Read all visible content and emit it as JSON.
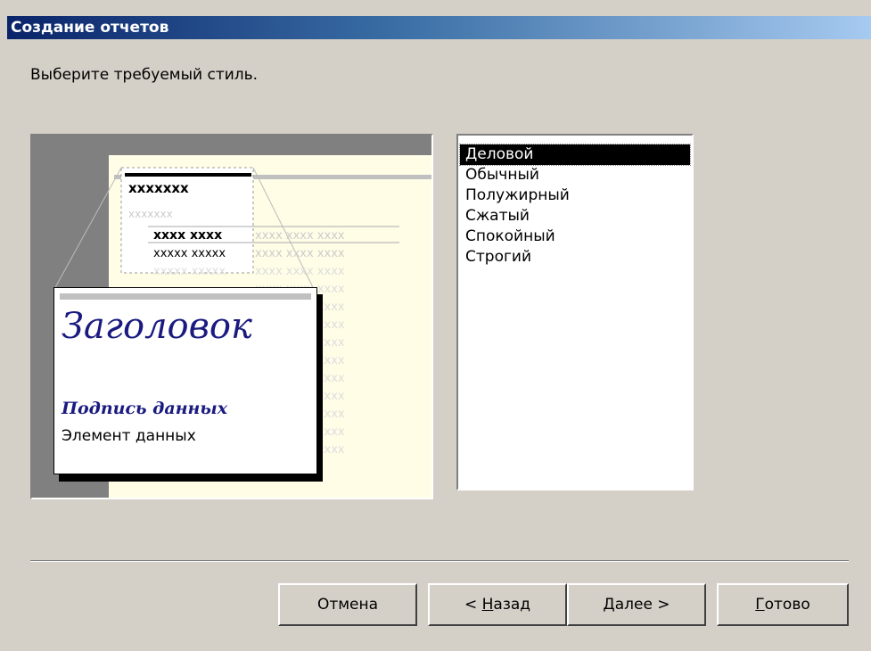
{
  "window": {
    "title": "Создание отчетов"
  },
  "prompt": "Выберите требуемый стиль.",
  "preview": {
    "heading_sample": "Заголовок",
    "label_sample": "Подпись данных",
    "field_sample": "Элемент данных",
    "placeholder_short": "xxxxxxx",
    "placeholder_row1": "xxxx xxxx",
    "placeholder_row2": "xxxxx xxxxx",
    "placeholder_faint": "xxxx xxxx xxxx"
  },
  "styles": {
    "items": [
      "Деловой",
      "Обычный",
      "Полужирный",
      "Сжатый",
      "Спокойный",
      "Строгий"
    ],
    "selected": "Деловой"
  },
  "buttons": {
    "cancel": "Отмена",
    "back_prefix": "< ",
    "back_accel": "Н",
    "back_rest": "азад",
    "next_accel": "Д",
    "next_rest": "алее >",
    "finish_accel": "Г",
    "finish_rest": "отово"
  },
  "colors": {
    "titlebar_start": "#0a246a",
    "titlebar_end": "#a6caf0",
    "sample_text": "#1a1a80",
    "preview_paper": "#fffde6"
  }
}
